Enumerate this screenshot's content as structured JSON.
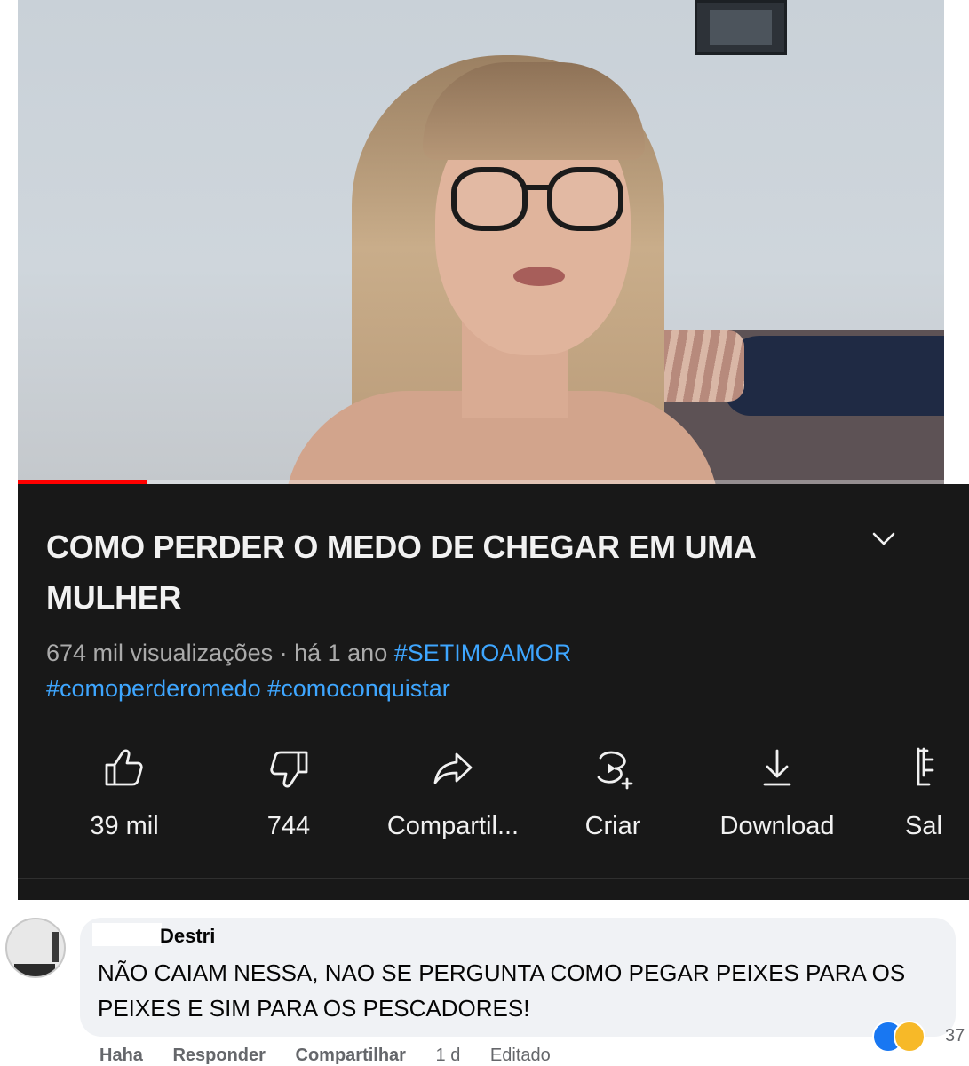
{
  "video": {
    "title": "COMO PERDER O MEDO DE CHEGAR EM UMA MULHER",
    "progress_fraction": 0.14
  },
  "meta": {
    "views": "674 mil visualizações · há 1 ano",
    "hashtag_1": "#SETIMOAMOR",
    "hashtag_2": "#comoperderomedo",
    "hashtag_3": "#comoconquistar"
  },
  "actions": [
    {
      "label": "39 mil",
      "icon": "like-icon"
    },
    {
      "label": "744",
      "icon": "dislike-icon"
    },
    {
      "label": "Compartil...",
      "icon": "share-icon"
    },
    {
      "label": "Criar",
      "icon": "create-icon"
    },
    {
      "label": "Download",
      "icon": "download-icon"
    },
    {
      "label": "Sal",
      "icon": "save-icon"
    }
  ],
  "comment": {
    "author": "Destri",
    "text": "NÃO CAIAM NESSA, NAO SE PERGUNTA COMO PEGAR PEIXES PARA OS PEIXES E SIM PARA OS PESCADORES!",
    "reaction_count": "37",
    "footer": {
      "haha": "Haha",
      "reply": "Responder",
      "share": "Compartilhar",
      "time": "1 d",
      "edited": "Editado"
    }
  },
  "colors": {
    "panel_bg": "#181818",
    "hashtag": "#3ea6ff",
    "progress": "#ff0000",
    "bubble": "#f0f2f5"
  }
}
